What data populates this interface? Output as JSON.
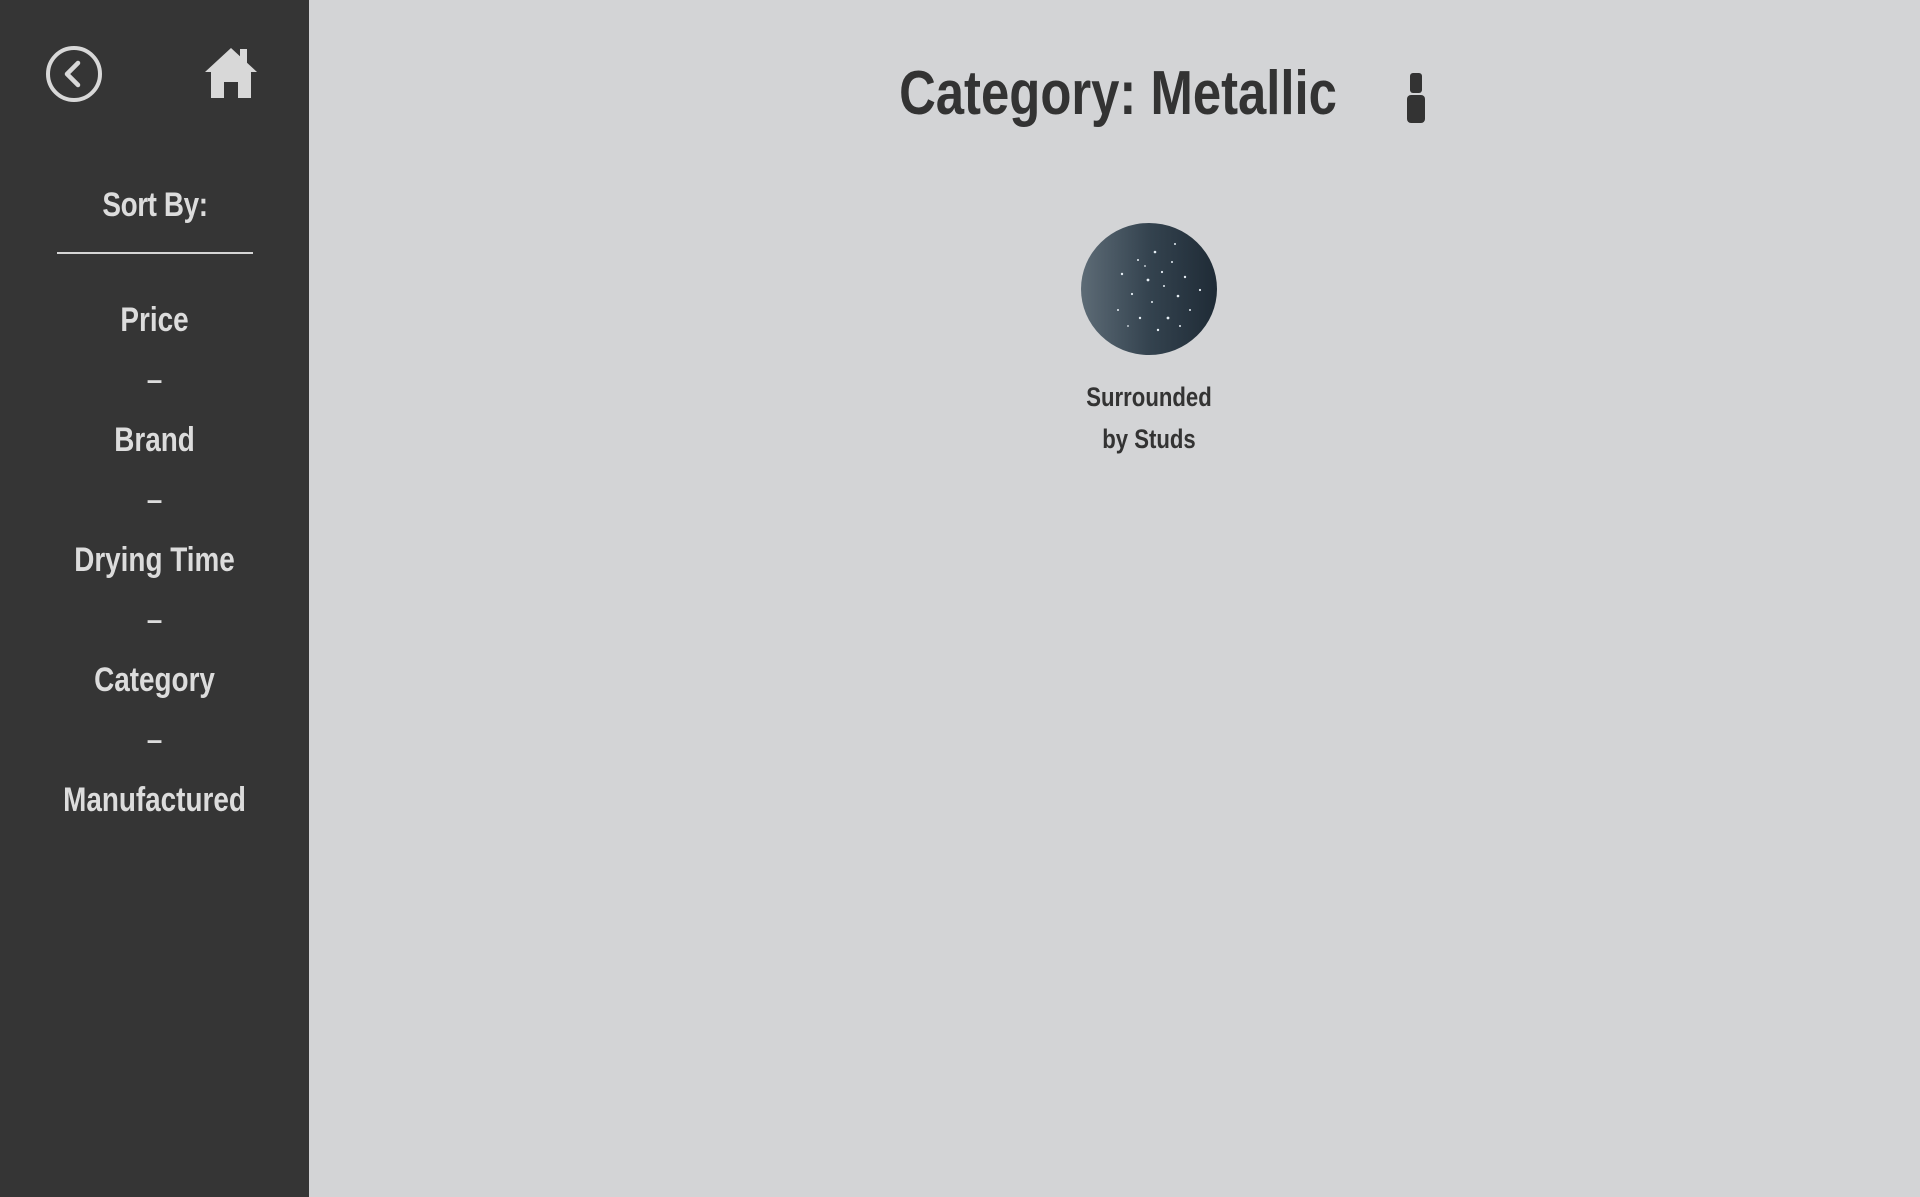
{
  "nav": {
    "back_icon": "circle-chevron-left-icon",
    "home_icon": "home-icon"
  },
  "sidebar": {
    "sort_title": "Sort By:",
    "items": [
      {
        "label": "Price"
      },
      {
        "label": "Brand"
      },
      {
        "label": "Drying Time"
      },
      {
        "label": "Category"
      },
      {
        "label": "Manufactured"
      }
    ],
    "separator": "–"
  },
  "main": {
    "title": "Category: Metallic",
    "title_icon": "nail-polish-icon"
  },
  "products": [
    {
      "name_line1": "Surrounded",
      "name_line2": "by Studs",
      "swatch_color": "#3a4a57"
    }
  ],
  "colors": {
    "sidebar_bg": "#353535",
    "page_bg": "#d3d4d6",
    "sidebar_text": "#dcdcdc",
    "main_text": "#333333"
  }
}
